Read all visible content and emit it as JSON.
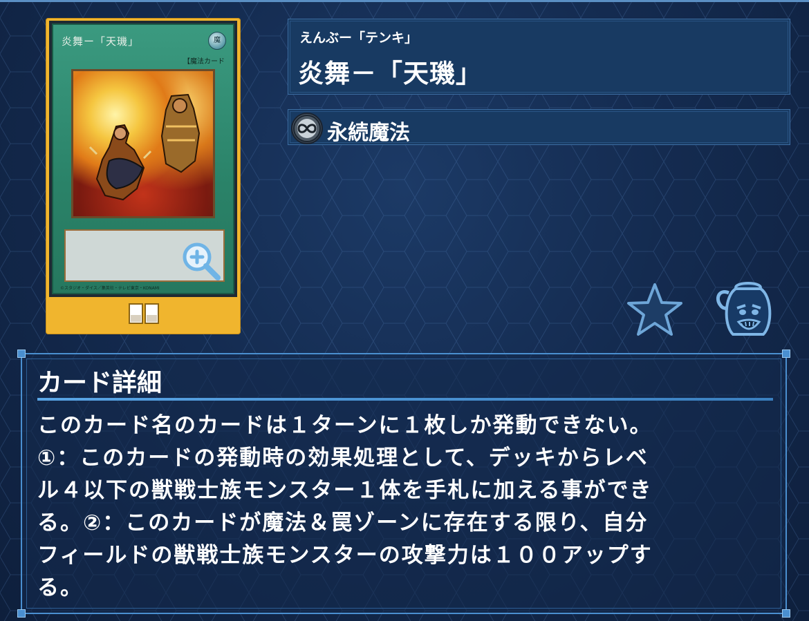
{
  "card": {
    "card_name": "炎舞ー「天璣」",
    "attribute_symbol": "魔",
    "card_type": "【魔法カード",
    "copyright": "©スタジオ・ダイス／集英社・テレビ東京・KONAMI",
    "frame_color": "#f0b52e"
  },
  "header": {
    "ruby": "えんぶー「テンキ」",
    "title": "炎舞－「天璣」"
  },
  "spell_type": {
    "icon": "continuous-icon",
    "label": "永続魔法"
  },
  "actions": {
    "favorite_icon": "star-icon",
    "pot_icon": "pot-of-greed-icon"
  },
  "details": {
    "heading": "カード詳細",
    "text": "このカード名のカードは１ターンに１枚しか発動できない。\n①：このカードの発動時の効果処理として、デッキからレベ\nル４以下の獣戦士族モンスター１体を手札に加える事ができ\nる。②：このカードが魔法＆罠ゾーンに存在する限り、自分\nフィールドの獣戦士族モンスターの攻撃力は１００アップす\nる。"
  }
}
